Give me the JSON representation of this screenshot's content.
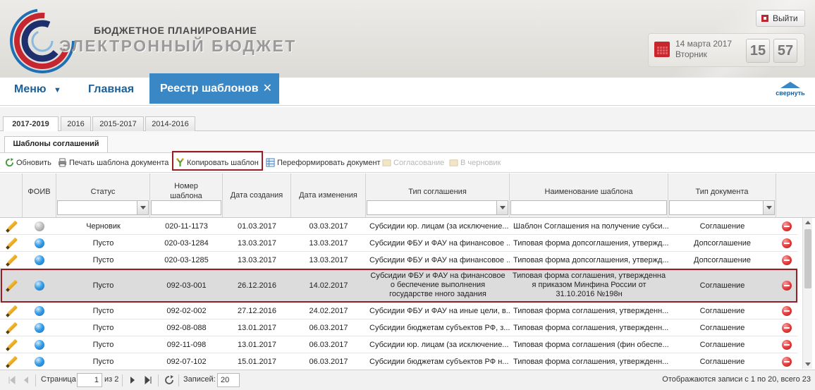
{
  "header": {
    "brand_top": "БЮДЖЕТНОЕ ПЛАНИРОВАНИЕ",
    "brand_main": "ЭЛЕКТРОННЫЙ БЮДЖЕТ",
    "logout_label": "Выйти",
    "date": "14 марта 2017",
    "weekday": "Вторник",
    "hour": "15",
    "minute": "57"
  },
  "nav": {
    "menu_label": "Меню",
    "home_label": "Главная",
    "active_tab_label": "Реестр шаблонов",
    "close_glyph": "✕",
    "collapse_label": "свернуть"
  },
  "year_tabs": [
    "2017-2019",
    "2016",
    "2015-2017",
    "2014-2016"
  ],
  "panel_tab": "Шаблоны соглашений",
  "toolbar": {
    "refresh": "Обновить",
    "print": "Печать шаблона документа",
    "copy": "Копировать шаблон",
    "reform": "Переформировать документ",
    "approve": "Согласование",
    "draft": "В черновик"
  },
  "columns": {
    "foiv": "ФОИВ",
    "status": "Статус",
    "number": "Номер шаблона",
    "created": "Дата создания",
    "modified": "Дата изменения",
    "agreement_type": "Тип соглашения",
    "name": "Наименование шаблона",
    "doc_type": "Тип документа"
  },
  "rows": [
    {
      "foiv": "grey",
      "status": "Черновик",
      "number": "020-11-1173",
      "created": "01.03.2017",
      "modified": "03.03.2017",
      "agreement_type": "Субсидии юр. лицам (за исключение...",
      "name": "Шаблон Соглашения на получение субси...",
      "doc_type": "Соглашение"
    },
    {
      "foiv": "blue",
      "status": "Пусто",
      "number": "020-03-1284",
      "created": "13.03.2017",
      "modified": "13.03.2017",
      "agreement_type": "Субсидии ФБУ и ФАУ на финансовое ...",
      "name": "Типовая форма допсоглашения, утвержд...",
      "doc_type": "Допсоглашение"
    },
    {
      "foiv": "blue",
      "status": "Пусто",
      "number": "020-03-1285",
      "created": "13.03.2017",
      "modified": "13.03.2017",
      "agreement_type": "Субсидии ФБУ и ФАУ на финансовое ...",
      "name": "Типовая форма допсоглашения, утвержд...",
      "doc_type": "Допсоглашение"
    },
    {
      "foiv": "blue",
      "status": "Пусто",
      "number": "092-03-001",
      "created": "26.12.2016",
      "modified": "14.02.2017",
      "agreement_type": "Субсидии ФБУ и ФАУ на финансовое о беспечение выполнения государстве нного задания",
      "name": "Типовая форма соглашения, утвержденна я приказом Минфина России от 31.10.2016 №198н",
      "doc_type": "Соглашение",
      "selected": true
    },
    {
      "foiv": "blue",
      "status": "Пусто",
      "number": "092-02-002",
      "created": "27.12.2016",
      "modified": "24.02.2017",
      "agreement_type": "Субсидии ФБУ и ФАУ на иные цели, в...",
      "name": "Типовая форма соглашения, утвержденн...",
      "doc_type": "Соглашение"
    },
    {
      "foiv": "blue",
      "status": "Пусто",
      "number": "092-08-088",
      "created": "13.01.2017",
      "modified": "06.03.2017",
      "agreement_type": "Субсидии бюджетам субъектов РФ, з...",
      "name": "Типовая форма соглашения, утвержденн...",
      "doc_type": "Соглашение"
    },
    {
      "foiv": "blue",
      "status": "Пусто",
      "number": "092-11-098",
      "created": "13.01.2017",
      "modified": "06.03.2017",
      "agreement_type": "Субсидии юр. лицам (за исключение...",
      "name": "Типовая форма соглашения (фин обеспе...",
      "doc_type": "Соглашение"
    },
    {
      "foiv": "blue",
      "status": "Пусто",
      "number": "092-07-102",
      "created": "15.01.2017",
      "modified": "06.03.2017",
      "agreement_type": "Субсидии бюджетам субъектов РФ н...",
      "name": "Типовая форма соглашения, утвержденн...",
      "doc_type": "Соглашение"
    }
  ],
  "pager": {
    "page_label": "Страница",
    "page_value": "1",
    "of_label": "из 2",
    "records_label": "Записей:",
    "records_value": "20",
    "summary": "Отображаются записи с 1 по 20, всего 23"
  },
  "colors": {
    "accent": "#3a87c5",
    "nav_text": "#1d5f97",
    "highlight_border": "#9a1c25"
  }
}
